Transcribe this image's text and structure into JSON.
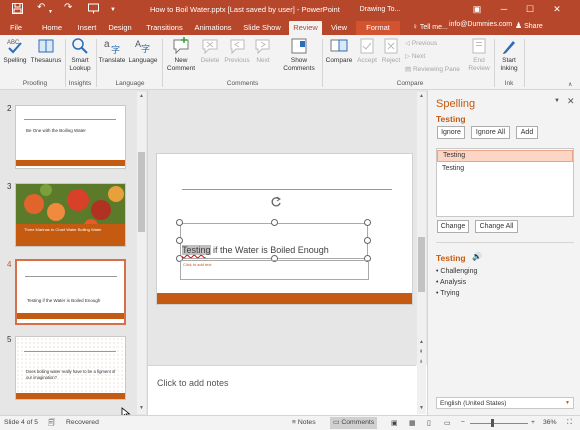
{
  "titlebar": {
    "title": "How to Boil Water.pptx [Last saved by user] - PowerPoint",
    "context_label": "Drawing To...",
    "save_icon": "save-icon",
    "undo_icon": "undo-icon",
    "redo_icon": "redo-icon",
    "start_icon": "start-icon",
    "customize_icon": "dropdown-icon"
  },
  "tabs": [
    "File",
    "Home",
    "Insert",
    "Design",
    "Transitions",
    "Animations",
    "Slide Show",
    "Review",
    "View",
    "Format"
  ],
  "active_tab": "Review",
  "tellme": "Tell me...",
  "account": "info@Dummies.com",
  "share": "Share",
  "ribbon": {
    "spelling": "Spelling",
    "thesaurus": "Thesaurus",
    "smart_lookup": "Smart Lookup",
    "translate": "Translate",
    "language": "Language",
    "new_comment": "New Comment",
    "delete": "Delete",
    "previous": "Previous",
    "next": "Next",
    "show_comments": "Show Comments",
    "compare": "Compare",
    "accept": "Accept",
    "reject": "Reject",
    "previous_small": "Previous",
    "next_small": "Next",
    "reviewing_pane": "Reviewing Pane",
    "end_review": "End Review",
    "start_inking": "Start Inking",
    "groups": {
      "proofing": "Proofing",
      "insights": "Insights",
      "language": "Language",
      "comments": "Comments",
      "compare": "Compare",
      "ink": "Ink"
    }
  },
  "slides": [
    {
      "number": "2",
      "title": "Be One with the Boiling Water"
    },
    {
      "number": "3",
      "title": "Three Marinas to Chart Water Boiling Water"
    },
    {
      "number": "4",
      "title": "Testing if the Water is Boiled Enough"
    },
    {
      "number": "5",
      "title": "Does boiling water really have to be a figment of our imagination?"
    }
  ],
  "current_slide": {
    "title_rest": " if the Water is Boiled Enough",
    "title_highlight": "Testing",
    "subtitle_placeholder": "Click to add text"
  },
  "notes_placeholder": "Click to add notes",
  "spelling_pane": {
    "title": "Spelling",
    "word": "Testing",
    "ignore": "Ignore",
    "ignore_all": "Ignore All",
    "add": "Add",
    "suggestions": [
      "Testing",
      "Testing"
    ],
    "change": "Change",
    "change_all": "Change All",
    "def_word": "Testing",
    "synonyms": [
      "Challenging",
      "Analysis",
      "Trying"
    ],
    "language": "English (United States)",
    "dropdown_icon": "chevron-down-icon",
    "close_icon": "close-icon"
  },
  "status": {
    "slide": "Slide 4 of 5",
    "recovered": "Recovered",
    "notes": "Notes",
    "comments": "Comments",
    "zoom": "36%"
  },
  "colors": {
    "accent": "#b7472a",
    "slide_bar": "#c55a11",
    "highlight": "#fcd5c5"
  }
}
